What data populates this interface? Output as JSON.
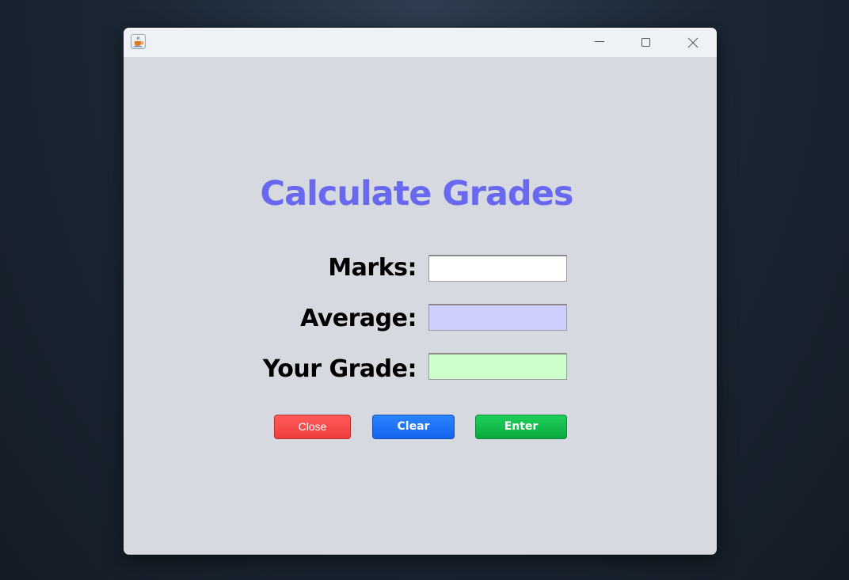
{
  "window": {
    "icon": "java-cup-icon",
    "controls": {
      "minimize_icon": "minimize-icon",
      "maximize_icon": "maximize-icon",
      "close_icon": "close-icon"
    }
  },
  "form": {
    "title": "Calculate Grades",
    "fields": {
      "marks": {
        "label": "Marks:",
        "value": ""
      },
      "average": {
        "label": "Average:",
        "value": ""
      },
      "grade": {
        "label": "Your Grade:",
        "value": ""
      }
    },
    "buttons": {
      "close": "Close",
      "clear": "Clear",
      "enter": "Enter"
    }
  },
  "colors": {
    "title": "#6868f0",
    "panel_background": "#d6d9e0",
    "average_field": "#cfcfff",
    "grade_field": "#ccffcc",
    "close_button": "#ff4d4d",
    "clear_button": "#1a73ff",
    "enter_button": "#14bf4a"
  }
}
